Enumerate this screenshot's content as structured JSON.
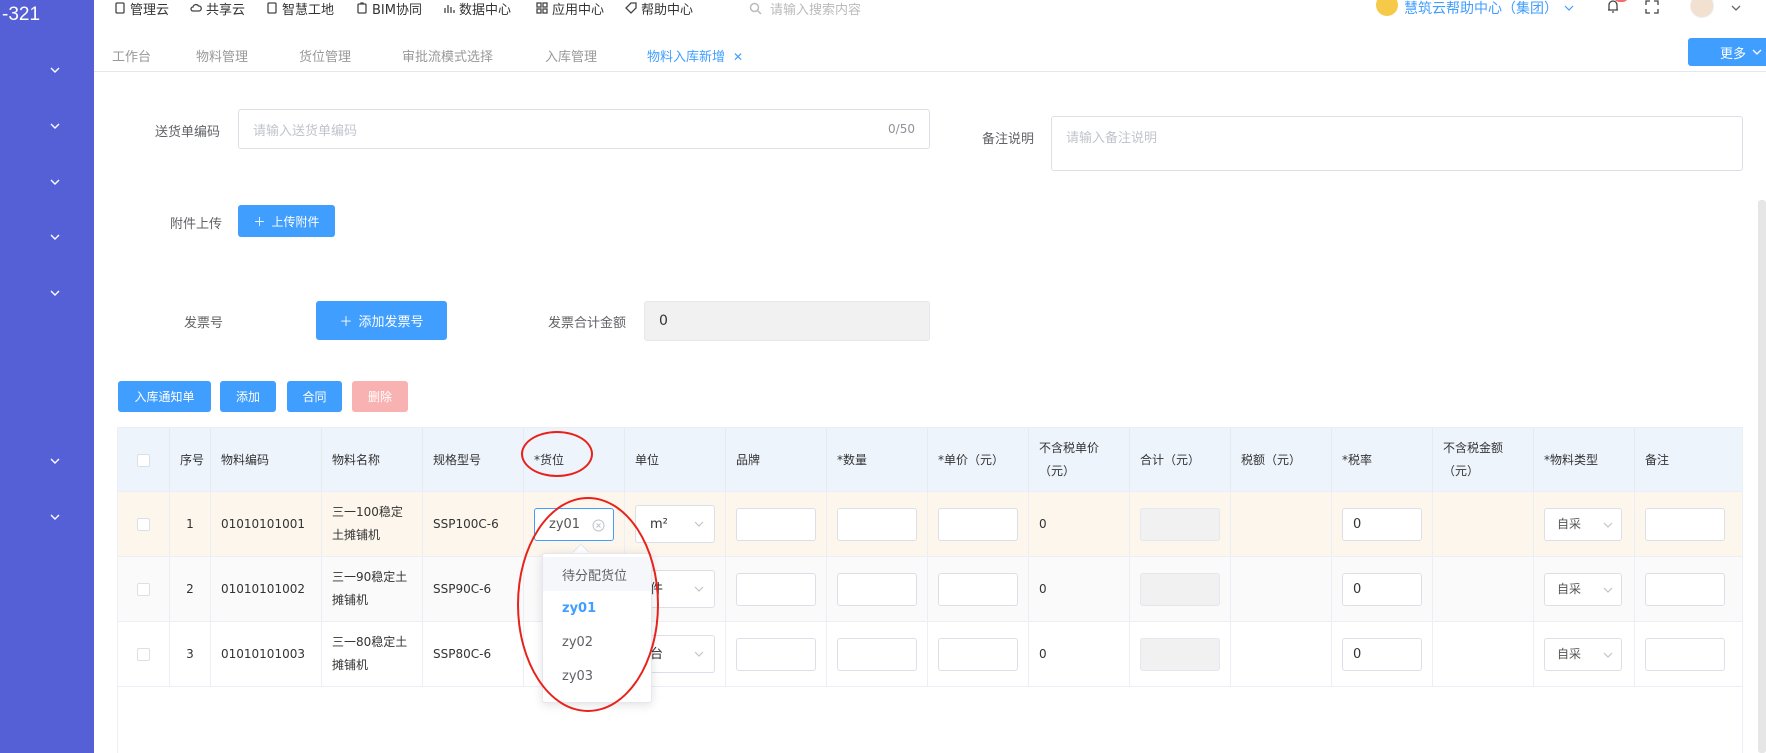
{
  "sidebar": {
    "title": "-321",
    "chevron_tops": [
      64,
      120,
      176,
      231,
      287,
      455,
      511
    ]
  },
  "topnav": {
    "items": [
      {
        "label": "管理云",
        "icon": "document-icon"
      },
      {
        "label": "共享云",
        "icon": "cloud-icon"
      },
      {
        "label": "智慧工地",
        "icon": "document-icon"
      },
      {
        "label": "BIM协同",
        "icon": "clipboard-icon"
      },
      {
        "label": "数据中心",
        "icon": "bar-chart-icon"
      },
      {
        "label": "应用中心",
        "icon": "grid-icon"
      },
      {
        "label": "帮助中心",
        "icon": "tag-icon"
      }
    ],
    "search_placeholder": "请输入搜索内容",
    "help_center": "慧筑云帮助中心（集团）"
  },
  "tabs": [
    {
      "label": "工作台",
      "active": false
    },
    {
      "label": "物料管理",
      "active": false
    },
    {
      "label": "货位管理",
      "active": false
    },
    {
      "label": "审批流模式选择",
      "active": false
    },
    {
      "label": "入库管理",
      "active": false
    },
    {
      "label": "物料入库新增",
      "active": true
    }
  ],
  "more_label": "更多",
  "form": {
    "delivery_label": "送货单编码",
    "delivery_placeholder": "请输入送货单编码",
    "delivery_counter": "0/50",
    "remark_label": "备注说明",
    "remark_placeholder": "请输入备注说明",
    "attachment_label": "附件上传",
    "upload_button": "上传附件",
    "invoice_label": "发票号",
    "add_invoice_button": "添加发票号",
    "invoice_total_label": "发票合计金额",
    "invoice_total_value": "0"
  },
  "actions": {
    "notice": "入库通知单",
    "add": "添加",
    "contract": "合同",
    "delete": "删除"
  },
  "table": {
    "headers": {
      "seq": "序号",
      "code": "物料编码",
      "name": "物料名称",
      "spec": "规格型号",
      "location": "*货位",
      "unit": "单位",
      "brand": "品牌",
      "qty": "*数量",
      "price": "*单价（元）",
      "price_ex_l1": "不含税单价",
      "price_ex_l2": "（元）",
      "total": "合计（元）",
      "tax": "税额（元）",
      "tax_rate": "*税率",
      "amount_ex_l1": "不含税金额",
      "amount_ex_l2": "（元）",
      "type": "*物料类型",
      "remark": "备注"
    },
    "rows": [
      {
        "seq": "1",
        "code": "01010101001",
        "name_l1": "三一100稳定",
        "name_l2": "土摊铺机",
        "spec": "SSP100C-6",
        "location": "zy01",
        "unit": "m²",
        "price_ex": "0",
        "tax_rate": "0",
        "type": "自采"
      },
      {
        "seq": "2",
        "code": "01010101002",
        "name_l1": "三一90稳定土",
        "name_l2": "摊铺机",
        "spec": "SSP90C-6",
        "location": "",
        "unit": "件",
        "price_ex": "0",
        "tax_rate": "0",
        "type": "自采"
      },
      {
        "seq": "3",
        "code": "01010101003",
        "name_l1": "三一80稳定土",
        "name_l2": "摊铺机",
        "spec": "SSP80C-6",
        "location": "",
        "unit": "台",
        "price_ex": "0",
        "tax_rate": "0",
        "type": "自采"
      }
    ]
  },
  "dropdown": {
    "options": [
      "待分配货位",
      "zy01",
      "zy02",
      "zy03"
    ],
    "selected": "zy01"
  },
  "colors": {
    "primary": "#409eff",
    "sidebar": "#5560d6",
    "annotation": "#e8221b"
  }
}
